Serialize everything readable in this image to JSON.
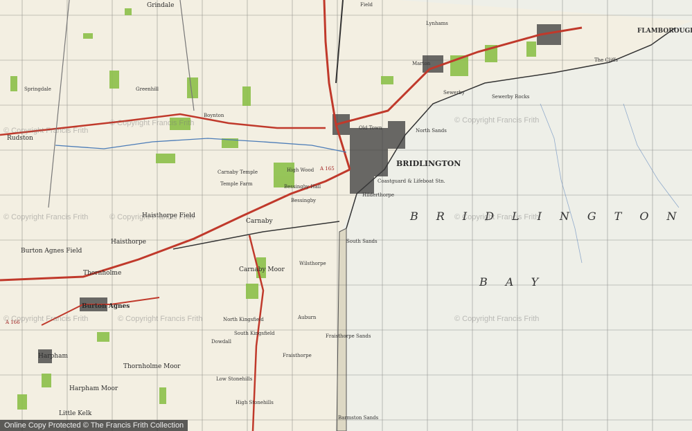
{
  "places": {
    "bridlington": "BRIDLINGTON",
    "bay_word1": "BRIDLINGTON",
    "bay_word2": "BAY",
    "rudston": "Rudston",
    "grindale": "Grindale",
    "flamborough": "FLAMBOROUGH HEAD",
    "boynton": "Boynton",
    "carnaby": "Carnaby",
    "haisthorpe": "Haisthorpe",
    "haisthorpe_field": "Haisthorpe Field",
    "burton_agnes": "Burton Agnes",
    "burton_agnes_field": "Burton Agnes Field",
    "thornholme": "Thornholme",
    "harpham": "Harpham",
    "harpham_moor": "Harpham Moor",
    "thornholme_moor": "Thornholme Moor",
    "little_kelk": "Little Kelk",
    "bessingby": "Bessingby",
    "hilderthorpe": "Hilderthorpe",
    "old_town": "Old Town",
    "sewerby": "Sewerby",
    "sewerby_rocks": "Sewerby Rocks",
    "south_sands": "South Sands",
    "north_sands": "North Sands",
    "fraisthorpe": "Fraisthorpe",
    "fraisthorpe_sands": "Fraisthorpe Sands",
    "wilsthorpe": "Wilsthorpe",
    "auburn": "Auburn",
    "carnaby_moor": "Carnaby Moor",
    "barmston_sands": "Barmston Sands",
    "the_cliffs": "The Cliffs",
    "marton": "Marton",
    "lynhams": "Lynhams",
    "field": "Field",
    "springdale": "Springdale",
    "greenhill": "Greenhill",
    "carnaby_temple": "Carnaby Temple",
    "temple_farm": "Temple Farm",
    "bessingby_hall": "Bessingby Hall",
    "high_wood": "High Wood",
    "north_kingsfield": "North Kingsfield",
    "south_kingsfield": "South Kingsfield",
    "low_stonehills": "Low Stonehills",
    "high_stonehills": "High Stonehills",
    "dowdall": "Dowdall",
    "coastguard": "Coastguard & Lifeboat Stn."
  },
  "roads": {
    "a165": "A 165",
    "a166": "A 166"
  },
  "watermarks": [
    "© Copyright Francis Frith",
    "© Copyright Francis Frith",
    "© Copyright Francis Frith",
    "© Copyright Francis Frith",
    "© Copyright Francis Frith",
    "© Copyright Francis Frith",
    "© Copyright Francis Frith",
    "© Copyright Francis Frith",
    "© Copyright Francis Frith"
  ],
  "footer": "Online Copy Protected © The Francis Frith Collection",
  "colors": {
    "paper": "#f3efe2",
    "sea": "#eef0ea",
    "grid": "#4a4a4a",
    "woods": "#8cc04a",
    "roads": "#c0392b",
    "town": "#2a2a2a"
  }
}
